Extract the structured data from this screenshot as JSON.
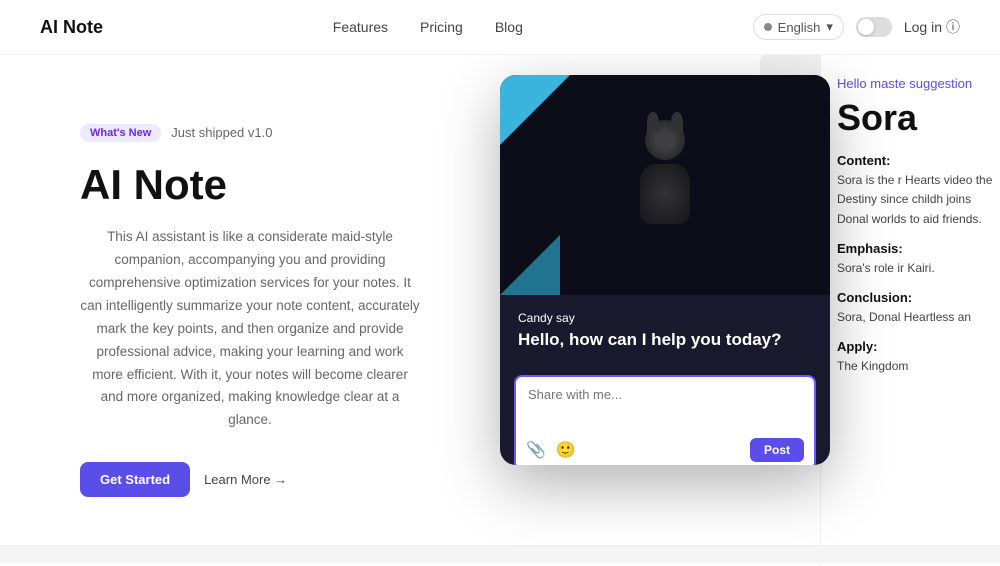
{
  "navbar": {
    "logo": "AI Note",
    "links": [
      {
        "label": "Features",
        "id": "features"
      },
      {
        "label": "Pricing",
        "id": "pricing"
      },
      {
        "label": "Blog",
        "id": "blog"
      }
    ],
    "lang_selector": {
      "label": "English",
      "chevron": "▾"
    },
    "login_label": "Log in",
    "login_icon": "ⓘ"
  },
  "hero": {
    "badge_tag": "What's New",
    "badge_text": "Just shipped v1.0",
    "title": "AI Note",
    "description": "This AI assistant is like a considerate maid-style companion, accompanying you and providing comprehensive optimization services for your notes. It can intelligently summarize your note content, accurately mark the key points, and then organize and provide professional advice, making your learning and work more efficient. With it, your notes will become clearer and more organized, making knowledge clear at a glance.",
    "cta_primary": "Get Started",
    "cta_secondary": "Learn More →"
  },
  "chat_widget": {
    "sender": "Candy",
    "sender_suffix": "say",
    "greeting": "Hello, how can I help you today?",
    "input_placeholder": "Share with me...",
    "post_button": "Post",
    "attach_icon": "📎",
    "emoji_icon": "🙂"
  },
  "side_article": {
    "hello_text": "Hello maste suggestion",
    "title": "Sora",
    "content_label": "Content:",
    "content_text": "Sora is the r Hearts video the Destiny since childh joins Donal worlds to aid friends.",
    "emphasis_label": "Emphasis:",
    "emphasis_text": "Sora's role ir Kairi.",
    "conclusion_label": "Conclusion:",
    "conclusion_text": "Sora, Donal Heartless an",
    "apply_label": "Apply:",
    "apply_text": "The Kingdom"
  }
}
